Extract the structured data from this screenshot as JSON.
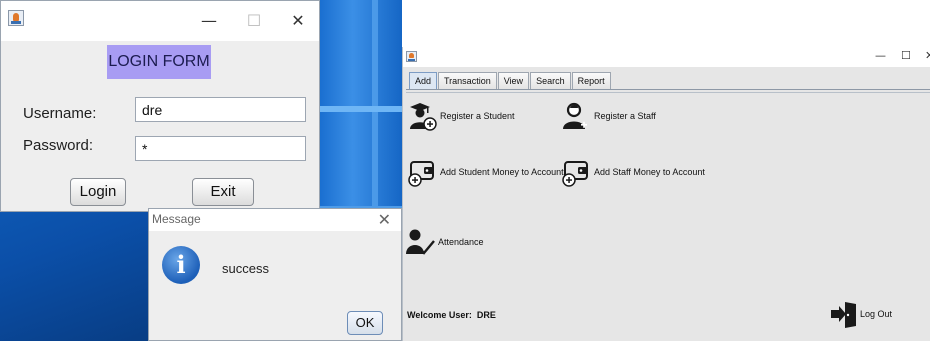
{
  "login_window": {
    "title_controls": {
      "minimize": "—",
      "maximize": "☐",
      "close": "✕"
    },
    "form_title": "LOGIN FORM",
    "username_label": "Username:",
    "username_value": "dre",
    "password_label": "Password:",
    "password_value": "*",
    "login_button": "Login",
    "exit_button": "Exit"
  },
  "message_dialog": {
    "title": "Message",
    "close": "✕",
    "icon": "info-icon",
    "text": "success",
    "ok_button": "OK"
  },
  "main_window": {
    "title_controls": {
      "minimize": "—",
      "maximize": "☐",
      "close": "✕"
    },
    "tabs": [
      {
        "label": "Add",
        "active": true
      },
      {
        "label": "Transaction",
        "active": false
      },
      {
        "label": "View",
        "active": false
      },
      {
        "label": "Search",
        "active": false
      },
      {
        "label": "Report",
        "active": false
      }
    ],
    "actions": {
      "register_student": "Register a Student",
      "register_staff": "Register a Staff",
      "add_student_money": "Add Student Money to Account",
      "add_staff_money": "Add Staff Money to Account",
      "attendance": "Attendance"
    },
    "welcome_label": "Welcome User:",
    "welcome_user": "DRE",
    "logout": "Log Out"
  }
}
